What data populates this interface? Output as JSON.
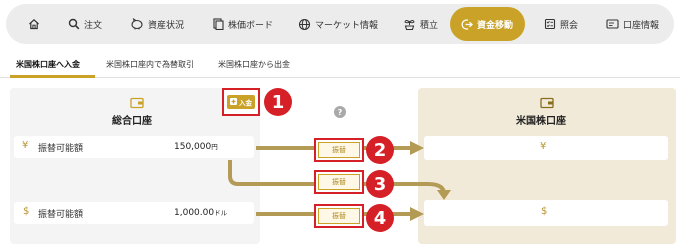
{
  "nav": {
    "items": [
      {
        "label": "",
        "icon": "home-icon"
      },
      {
        "label": "注文",
        "icon": "search-icon"
      },
      {
        "label": "資産状況",
        "icon": "piggy-bank-icon"
      },
      {
        "label": "株価ボード",
        "icon": "board-icon"
      },
      {
        "label": "マーケット情報",
        "icon": "globe-icon"
      },
      {
        "label": "積立",
        "icon": "sprout-icon"
      },
      {
        "label": "資金移動",
        "icon": "transfer-icon"
      },
      {
        "label": "照会",
        "icon": "checklist-icon"
      },
      {
        "label": "口座情報",
        "icon": "account-card-icon"
      }
    ]
  },
  "tabs": [
    {
      "label": "米国株口座へ入金"
    },
    {
      "label": "米国株口座内で為替取引"
    },
    {
      "label": "米国株口座から出金"
    }
  ],
  "left_panel": {
    "title": "総合口座",
    "deposit_label": "入金",
    "rows": [
      {
        "symbol": "¥",
        "label": "振替可能額",
        "amount": "150,000",
        "unit": "円"
      },
      {
        "symbol": "$",
        "label": "振替可能額",
        "amount": "1,000.00",
        "unit": "ドル"
      }
    ]
  },
  "right_panel": {
    "title": "米国株口座",
    "rows": [
      {
        "symbol": "¥"
      },
      {
        "symbol": "$"
      }
    ]
  },
  "help_label": "?",
  "transfer_buttons": [
    {
      "label": "振替",
      "badge": "2"
    },
    {
      "label": "振替",
      "badge": "3"
    },
    {
      "label": "振替",
      "badge": "4"
    }
  ],
  "deposit_badge": "1",
  "colors": {
    "accent": "#c9a227",
    "highlight": "#d62027",
    "right_panel_bg": "#f1ead8",
    "left_panel_bg": "#f4f4f4"
  }
}
